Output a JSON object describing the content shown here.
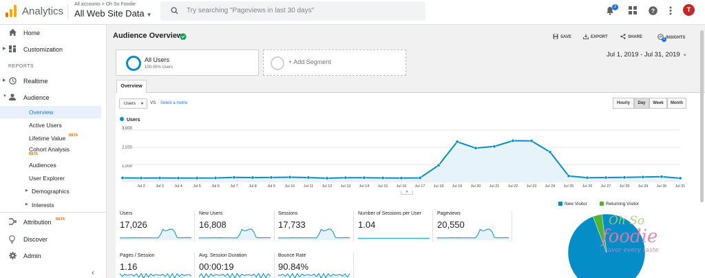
{
  "app": {
    "name": "Analytics"
  },
  "account": {
    "breadcrumb": "All accounts > Oh So Foodie",
    "property": "All Web Site Data"
  },
  "search": {
    "placeholder": "Try searching \"Pageviews in last 30 days\""
  },
  "header": {
    "notification_count": "2",
    "avatar_letter": "T"
  },
  "sidebar": {
    "home": "Home",
    "customization": "Customization",
    "reports_label": "REPORTS",
    "realtime": "Realtime",
    "audience": "Audience",
    "audience_items": [
      {
        "label": "Overview"
      },
      {
        "label": "Active Users"
      },
      {
        "label": "Lifetime Value",
        "beta": "BETA"
      },
      {
        "label": "Cohort Analysis",
        "beta": "BETA"
      },
      {
        "label": "Audiences"
      },
      {
        "label": "User Explorer"
      },
      {
        "label": "Demographics"
      },
      {
        "label": "Interests"
      }
    ],
    "attribution": "Attribution",
    "attribution_beta": "BETA",
    "discover": "Discover",
    "admin": "Admin"
  },
  "report": {
    "title": "Audience Overview",
    "toolbar": {
      "save": "SAVE",
      "export": "EXPORT",
      "share": "SHARE",
      "insights": "INSIGHTS",
      "insights_badge": "1"
    },
    "segment": {
      "name": "All Users",
      "sub": "100.00% Users",
      "add": "+ Add Segment"
    },
    "date_range": "Jul 1, 2019 - Jul 31, 2019",
    "tab": "Overview",
    "metric_select": "Users",
    "vs": "VS.",
    "select_metric": "Select a metric",
    "granularity": [
      "Hourly",
      "Day",
      "Week",
      "Month"
    ],
    "granularity_selected": "Day"
  },
  "chart_data": {
    "type": "area",
    "series": [
      {
        "name": "Users",
        "color": "#058dc7",
        "values": [
          220,
          210,
          215,
          210,
          210,
          215,
          250,
          240,
          245,
          260,
          240,
          200,
          230,
          230,
          215,
          210,
          220,
          950,
          2320,
          1950,
          2050,
          2380,
          2370,
          1720,
          330,
          230,
          240,
          250,
          270,
          290,
          200
        ]
      }
    ],
    "x": [
      "Jul 1",
      "Jul 2",
      "Jul 3",
      "Jul 4",
      "Jul 5",
      "Jul 6",
      "Jul 7",
      "Jul 8",
      "Jul 9",
      "Jul 10",
      "Jul 11",
      "Jul 12",
      "Jul 13",
      "Jul 14",
      "Jul 15",
      "Jul 16",
      "Jul 17",
      "Jul 18",
      "Jul 19",
      "Jul 20",
      "Jul 21",
      "Jul 22",
      "Jul 23",
      "Jul 24",
      "Jul 25",
      "Jul 26",
      "Jul 27",
      "Jul 28",
      "Jul 29",
      "Jul 30",
      "Jul 31"
    ],
    "x_tick_labels": [
      "Jul 2",
      "Jul 3",
      "Jul 4",
      "Jul 5",
      "Jul 6",
      "Jul 7",
      "Jul 8",
      "Jul 9",
      "Jul 10",
      "Jul 11",
      "Jul 12",
      "Jul 13",
      "Jul 14",
      "Jul 15",
      "Jul 16",
      "Jul 17",
      "Jul 18",
      "Jul 19",
      "Jul 20",
      "Jul 21",
      "Jul 22",
      "Jul 23",
      "Jul 24",
      "Jul 25",
      "Jul 26",
      "Jul 27",
      "Jul 28",
      "Jul 29",
      "Jul 30",
      "Jul 31"
    ],
    "y_ticks": [
      "3,000",
      "2,000",
      "1,000"
    ],
    "ylim": [
      0,
      3000
    ],
    "legend": "Users",
    "grid": true
  },
  "metrics": [
    {
      "name": "Users",
      "value": "17,026"
    },
    {
      "name": "New Users",
      "value": "16,808"
    },
    {
      "name": "Sessions",
      "value": "17,733"
    },
    {
      "name": "Number of Sessions per User",
      "value": "1.04"
    },
    {
      "name": "Pageviews",
      "value": "20,550"
    },
    {
      "name": "Pages / Session",
      "value": "1.16"
    },
    {
      "name": "Avg. Session Duration",
      "value": "00:00:19"
    },
    {
      "name": "Bounce Rate",
      "value": "90.84%"
    }
  ],
  "pie": {
    "legend": [
      {
        "label": "New Visitor",
        "color": "#058dc7"
      },
      {
        "label": "Returning Visitor",
        "color": "#50b432"
      }
    ],
    "values": [
      0.962,
      0.038
    ]
  },
  "watermark": {
    "line1": "Oh So",
    "line2": "foodie",
    "tagline": "savor every taste"
  }
}
